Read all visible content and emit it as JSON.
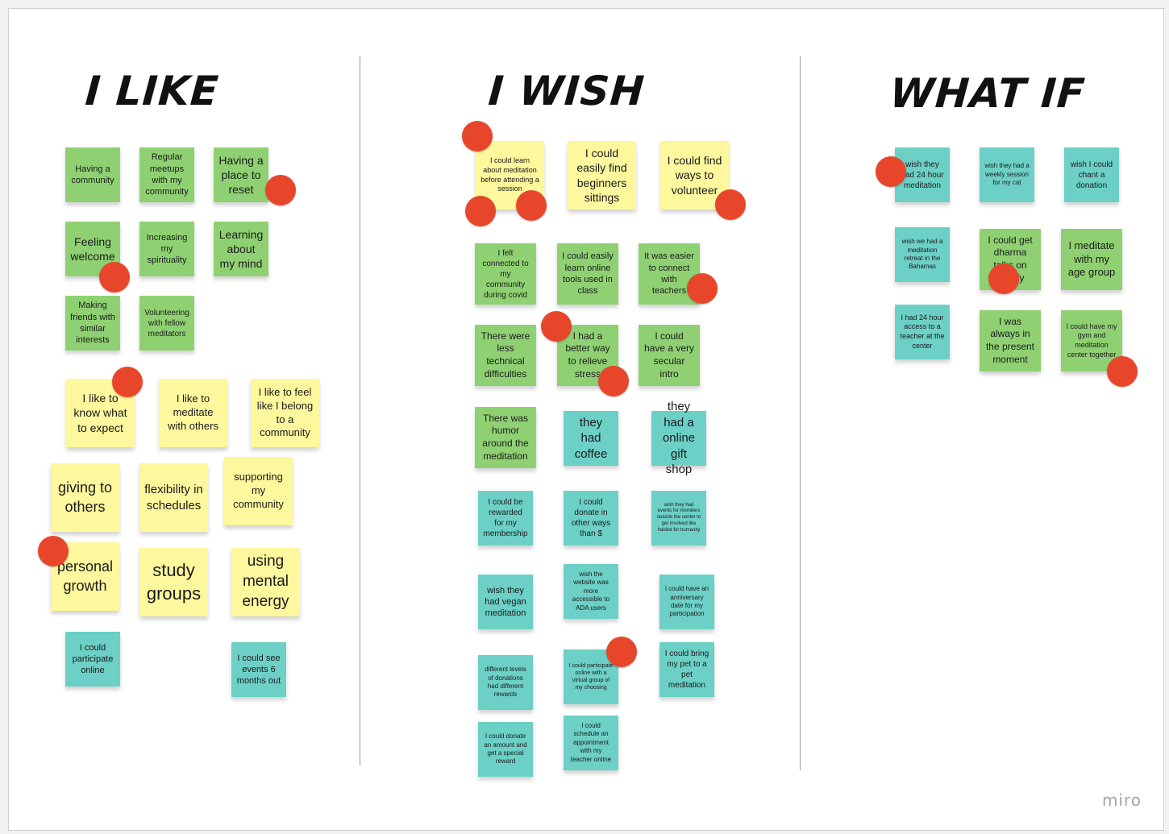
{
  "colors": {
    "green": "#8fd172",
    "yellow": "#fdf79d",
    "teal": "#6cd0c6",
    "dot": "#e8462b"
  },
  "brand": "miro",
  "columns": {
    "like": {
      "heading": "I like",
      "notes": [
        "Having a community",
        "Regular meetups with my community",
        "Having a place to reset",
        "Feeling welcome",
        "Increasing my spirituality",
        "Learning about my mind",
        "Making friends with similar interests",
        "Volunteering with fellow meditators",
        "I like to know what to expect",
        "I like to meditate with others",
        "I like to feel like I belong to a community",
        "giving to others",
        "flexibility in schedules",
        "supporting my community",
        "personal growth",
        "study groups",
        "using mental energy",
        "I  could participate online",
        "I  could see events 6 months out"
      ]
    },
    "wish": {
      "heading": "I wish",
      "notes": [
        "I could learn about meditation before attending a session",
        "I could easily find beginners sittings",
        "I could find ways to volunteer",
        "I felt connected to my community during covid",
        "I could easily learn online tools used in class",
        "It was easier to connect with teachers",
        "There were less technical difficulties",
        "I had a better way to relieve stress",
        "I could have a very secular intro",
        "There was humor around the meditation",
        "they had coffee",
        "they had a online gift shop",
        "I  could be rewarded for my membership",
        "I  could donate in other ways than $",
        "wish they had events for members outside the center to get involved like habitat for humanity",
        "wish they had vegan meditation",
        "wish the website was more accessible to ADA users",
        "I  could have an anniversary date for my participation",
        "different levels of donations had different rewards",
        "I  could participate online with a virtual group of my choosing",
        "I  could bring my pet to a pet meditation",
        "I  could donate an amount and get a special reward",
        "I  could schedule an appointment with my teacher online"
      ]
    },
    "whatif": {
      "heading": "What if",
      "notes": [
        "wish they had 24 hour meditation",
        "wish they had a weekly session for my cat",
        "wish I could chant a donation",
        "wish we had a meditation retreat in the Bahamas",
        "I could get dharma talks on spotify",
        "I meditate with my age group",
        "I  had 24 hour access to a teacher at the center",
        "I was always in the present moment",
        "I could have my gym and meditation center together"
      ]
    }
  }
}
